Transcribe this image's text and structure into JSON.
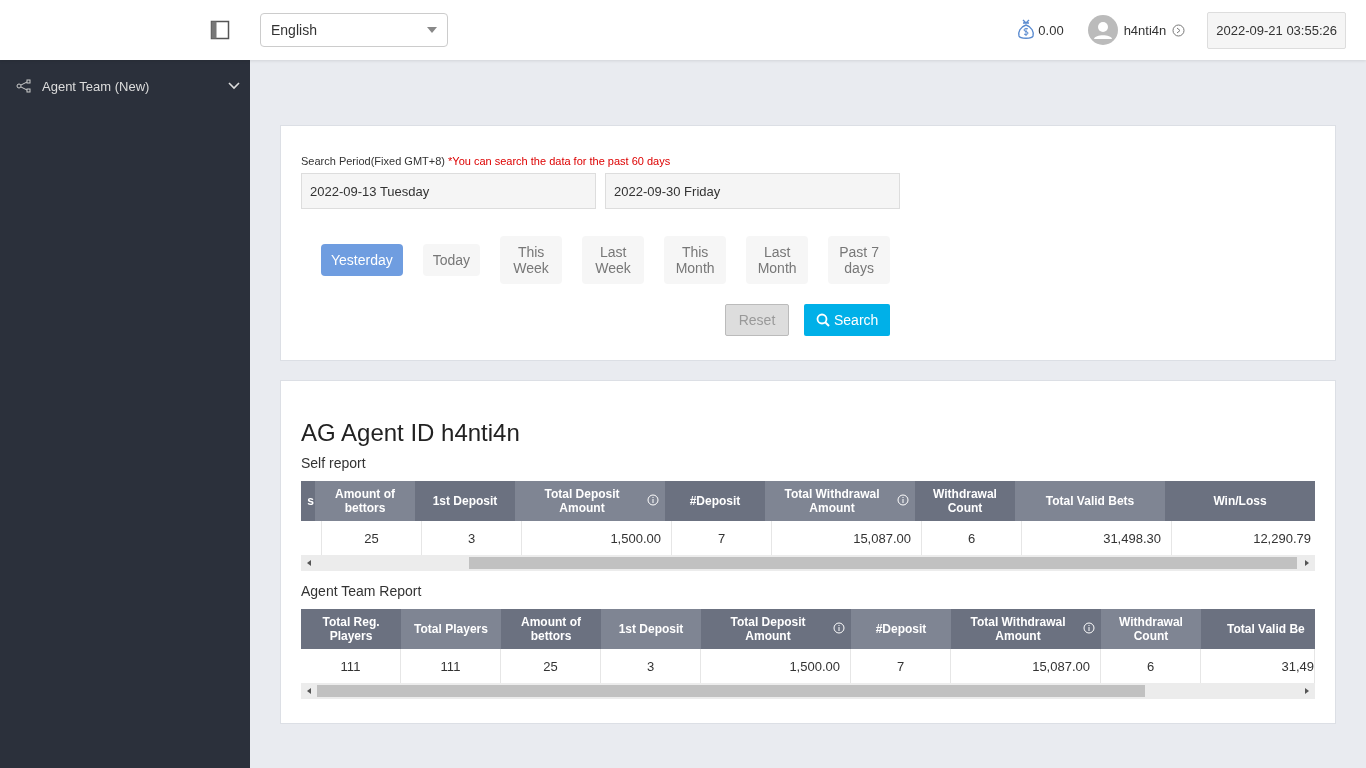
{
  "topbar": {
    "language": "English",
    "balance": "0.00",
    "username": "h4nti4n",
    "datetime": "2022-09-21 03:55:26"
  },
  "sidebar": {
    "items": [
      {
        "label": "Agent Team (New)",
        "expanded": true
      }
    ]
  },
  "search": {
    "label": "Search Period(Fixed GMT+8)",
    "note": "*You can search the data for the past 60 days",
    "start_date": "2022-09-13 Tuesday",
    "end_date": "2022-09-30 Friday",
    "presets": [
      {
        "label": "Yesterday",
        "selected": true
      },
      {
        "label": "Today",
        "selected": false
      },
      {
        "label": "This Week",
        "selected": false
      },
      {
        "label": "Last Week",
        "selected": false
      },
      {
        "label": "This Month",
        "selected": false
      },
      {
        "label": "Last Month",
        "selected": false
      },
      {
        "label": "Past 7 days",
        "selected": false
      }
    ],
    "reset_button": {
      "label": "Reset",
      "disabled": true
    },
    "search_button": "Search"
  },
  "report": {
    "title": "AG Agent ID h4nti4n",
    "tables": [
      {
        "title": "Self report",
        "columns": [
          {
            "header": "s",
            "info": false
          },
          {
            "header": "Amount of bettors",
            "info": false,
            "value": "25"
          },
          {
            "header": "1st Deposit",
            "info": false,
            "value": "3"
          },
          {
            "header": "Total Deposit Amount",
            "info": true,
            "value": "1,500.00"
          },
          {
            "header": "#Deposit",
            "info": false,
            "value": "7"
          },
          {
            "header": "Total Withdrawal Amount",
            "info": true,
            "value": "15,087.00"
          },
          {
            "header": "Withdrawal Count",
            "info": false,
            "value": "6"
          },
          {
            "header": "Total Valid Bets",
            "info": false,
            "value": "31,498.30"
          },
          {
            "header": "Win/Loss",
            "info": false,
            "value": "12,290.79"
          }
        ]
      },
      {
        "title": "Agent Team Report",
        "columns": [
          {
            "header": "Total Reg. Players",
            "info": false,
            "value": "111"
          },
          {
            "header": "Total Players",
            "info": false,
            "value": "111"
          },
          {
            "header": "Amount of bettors",
            "info": false,
            "value": "25"
          },
          {
            "header": "1st Deposit",
            "info": false,
            "value": "3"
          },
          {
            "header": "Total Deposit Amount",
            "info": true,
            "value": "1,500.00"
          },
          {
            "header": "#Deposit",
            "info": false,
            "value": "7"
          },
          {
            "header": "Total Withdrawal Amount",
            "info": true,
            "value": "15,087.00"
          },
          {
            "header": "Withdrawal Count",
            "info": false,
            "value": "6"
          },
          {
            "header": "Total Valid Be",
            "info": false,
            "value": "31,49"
          }
        ]
      }
    ]
  }
}
